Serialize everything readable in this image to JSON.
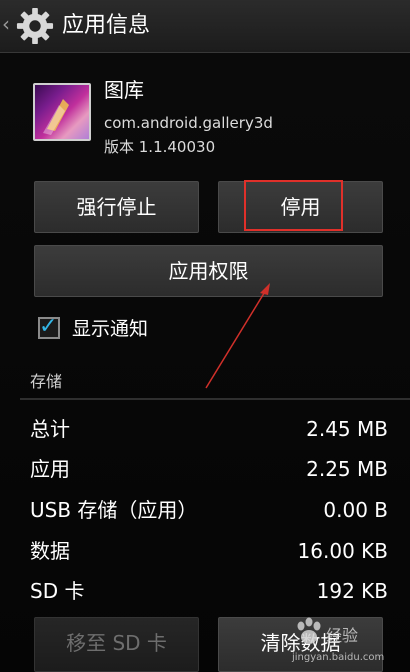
{
  "actionbar": {
    "title": "应用信息"
  },
  "app": {
    "name": "图库",
    "package": "com.android.gallery3d",
    "version": "版本 1.1.40030"
  },
  "buttons": {
    "force_stop": "强行停止",
    "disable": "停用",
    "permissions": "应用权限",
    "move_to_sd": "移至 SD 卡",
    "clear_data": "清除数据"
  },
  "notifications": {
    "label": "显示通知",
    "checked": true
  },
  "storage": {
    "header": "存储",
    "rows": [
      {
        "label": "总计",
        "value": "2.45 MB"
      },
      {
        "label": "应用",
        "value": "2.25 MB"
      },
      {
        "label": "USB 存储（应用）",
        "value": "0.00 B"
      },
      {
        "label": "数据",
        "value": "16.00 KB"
      },
      {
        "label": "SD 卡",
        "value": "192 KB"
      }
    ]
  },
  "watermark": {
    "text": "经验",
    "url": "jingyan.baidu.com"
  },
  "colors": {
    "accent": "#33b5e5",
    "annotation": "#e0302a"
  }
}
